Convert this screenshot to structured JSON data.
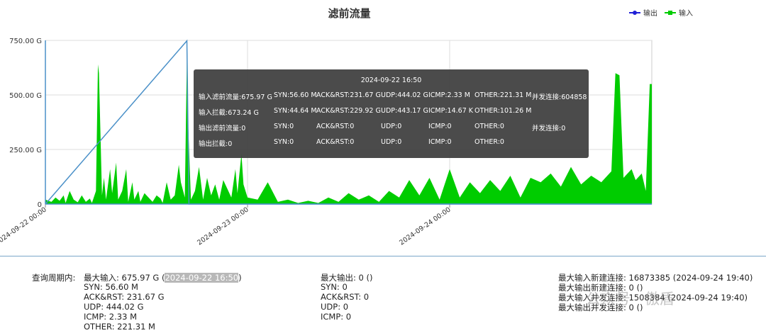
{
  "chart_data": {
    "type": "area",
    "title": "滤前流量",
    "y_ticks": [
      "750.00 G",
      "500.00 G",
      "250.00 G",
      "0"
    ],
    "ylim": [
      0,
      750
    ],
    "y_unit": "G",
    "x_ticks": [
      "2024-09-22 00:00",
      "2024-09-23 00:00",
      "2024-09-24 00:00"
    ],
    "grid": true,
    "legend": "top-right",
    "series": [
      {
        "name": "输出",
        "color": "#1f1fd6",
        "marker": "circle",
        "values": [
          [
            0,
            0
          ],
          [
            0.7,
            748
          ],
          [
            0.71,
            0
          ],
          [
            3,
            0
          ]
        ]
      },
      {
        "name": "输入",
        "color": "#00cc00",
        "marker": "square",
        "values": [
          [
            0.0,
            20
          ],
          [
            0.03,
            10
          ],
          [
            0.05,
            30
          ],
          [
            0.07,
            15
          ],
          [
            0.09,
            40
          ],
          [
            0.1,
            5
          ],
          [
            0.12,
            60
          ],
          [
            0.14,
            20
          ],
          [
            0.16,
            8
          ],
          [
            0.18,
            40
          ],
          [
            0.2,
            10
          ],
          [
            0.22,
            25
          ],
          [
            0.23,
            5
          ],
          [
            0.25,
            60
          ],
          [
            0.26,
            640
          ],
          [
            0.265,
            600
          ],
          [
            0.28,
            40
          ],
          [
            0.29,
            120
          ],
          [
            0.3,
            20
          ],
          [
            0.32,
            160
          ],
          [
            0.33,
            50
          ],
          [
            0.35,
            190
          ],
          [
            0.36,
            20
          ],
          [
            0.38,
            60
          ],
          [
            0.4,
            160
          ],
          [
            0.41,
            10
          ],
          [
            0.43,
            100
          ],
          [
            0.44,
            20
          ],
          [
            0.46,
            60
          ],
          [
            0.47,
            10
          ],
          [
            0.49,
            50
          ],
          [
            0.51,
            30
          ],
          [
            0.53,
            10
          ],
          [
            0.55,
            40
          ],
          [
            0.57,
            25
          ],
          [
            0.58,
            5
          ],
          [
            0.6,
            100
          ],
          [
            0.62,
            20
          ],
          [
            0.64,
            40
          ],
          [
            0.66,
            180
          ],
          [
            0.67,
            100
          ],
          [
            0.69,
            30
          ],
          [
            0.7,
            676
          ],
          [
            0.705,
            400
          ],
          [
            0.72,
            20
          ],
          [
            0.74,
            60
          ],
          [
            0.76,
            170
          ],
          [
            0.78,
            20
          ],
          [
            0.8,
            120
          ],
          [
            0.82,
            40
          ],
          [
            0.84,
            90
          ],
          [
            0.86,
            20
          ],
          [
            0.88,
            110
          ],
          [
            0.9,
            70
          ],
          [
            0.92,
            30
          ],
          [
            0.94,
            160
          ],
          [
            0.95,
            50
          ],
          [
            0.97,
            230
          ],
          [
            0.98,
            90
          ],
          [
            1.0,
            30
          ],
          [
            1.05,
            20
          ],
          [
            1.1,
            100
          ],
          [
            1.15,
            10
          ],
          [
            1.2,
            20
          ],
          [
            1.25,
            5
          ],
          [
            1.3,
            15
          ],
          [
            1.35,
            5
          ],
          [
            1.4,
            30
          ],
          [
            1.45,
            10
          ],
          [
            1.5,
            50
          ],
          [
            1.55,
            20
          ],
          [
            1.6,
            40
          ],
          [
            1.65,
            10
          ],
          [
            1.7,
            60
          ],
          [
            1.75,
            30
          ],
          [
            1.8,
            110
          ],
          [
            1.85,
            40
          ],
          [
            1.9,
            120
          ],
          [
            1.95,
            20
          ],
          [
            2.0,
            160
          ],
          [
            2.05,
            30
          ],
          [
            2.1,
            100
          ],
          [
            2.15,
            50
          ],
          [
            2.2,
            110
          ],
          [
            2.25,
            60
          ],
          [
            2.3,
            130
          ],
          [
            2.35,
            30
          ],
          [
            2.4,
            120
          ],
          [
            2.45,
            100
          ],
          [
            2.5,
            140
          ],
          [
            2.55,
            80
          ],
          [
            2.6,
            170
          ],
          [
            2.65,
            90
          ],
          [
            2.7,
            130
          ],
          [
            2.75,
            100
          ],
          [
            2.8,
            150
          ],
          [
            2.82,
            600
          ],
          [
            2.84,
            590
          ],
          [
            2.86,
            120
          ],
          [
            2.9,
            160
          ],
          [
            2.92,
            110
          ],
          [
            2.95,
            140
          ],
          [
            2.97,
            60
          ],
          [
            2.99,
            550
          ],
          [
            3.0,
            550
          ]
        ]
      }
    ],
    "x_domain_days": [
      0,
      3
    ]
  },
  "tooltip": {
    "time": "2024-09-22 16:50",
    "rows": [
      [
        "输入滤前流量:675.97 G",
        "SYN:56.60 M",
        "ACK&RST:231.67 G",
        "UDP:444.02 G",
        "ICMP:2.33 M",
        "OTHER:221.31 M",
        "并发连接:604858"
      ],
      [
        "输入拦截:673.24 G",
        "SYN:44.64 M",
        "ACK&RST:229.92 G",
        "UDP:443.17 G",
        "ICMP:14.67 K",
        "OTHER:101.26 M",
        ""
      ],
      [
        "输出滤前流量:0",
        "SYN:0",
        "ACK&RST:0",
        "UDP:0",
        "ICMP:0",
        "OTHER:0",
        "并发连接:0"
      ],
      [
        "输出拦截:0",
        "SYN:0",
        "ACK&RST:0",
        "UDP:0",
        "ICMP:0",
        "OTHER:0",
        ""
      ]
    ]
  },
  "summary": {
    "period_label": "查询周期内:",
    "max_in_prefix": "最大输入: 675.97 G (",
    "max_in_time": "2024-09-22 16:50",
    "max_in_suffix": ")",
    "in_lines": [
      "SYN: 56.60 M",
      "ACK&RST: 231.67 G",
      "UDP: 444.02 G",
      "ICMP: 2.33 M",
      "OTHER: 221.31 M"
    ],
    "max_out": "最大输出: 0 ()",
    "out_lines": [
      "SYN: 0",
      "ACK&RST: 0",
      "UDP: 0",
      "ICMP: 0"
    ],
    "conn_lines": [
      "最大输入新建连接: 16873385 (2024-09-24 19:40)",
      "最大输出新建连接: 0 ()",
      "最大输入并发连接: 1508384 (2024-09-24 19:40)",
      "最大输出并发连接: 0 ()"
    ]
  },
  "watermark": "公众号 · 傲盾"
}
